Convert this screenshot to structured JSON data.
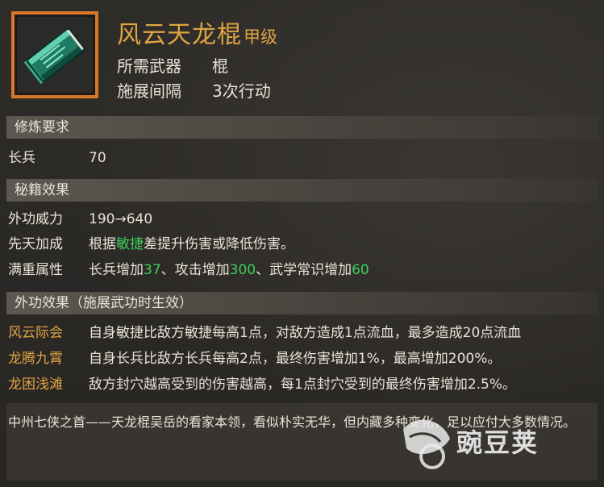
{
  "header": {
    "item_icon": "green-book-icon",
    "title": "风云天龙棍",
    "grade": "甲级",
    "meta": [
      {
        "label": "所需武器",
        "value": "棍"
      },
      {
        "label": "施展间隔",
        "value": "3次行动"
      }
    ]
  },
  "sections": {
    "requirements": "修炼要求",
    "effects": "秘籍效果",
    "external": "外功效果（施展武功时生效）"
  },
  "requirements": [
    {
      "label": "长兵",
      "value": "70"
    }
  ],
  "effects": {
    "power": {
      "label": "外功威力",
      "value": "190→640"
    },
    "innate": {
      "label": "先天加成",
      "pre": "根据",
      "hl": "敏捷",
      "post": "差提升伤害或降低伤害。"
    },
    "full": {
      "label": "满重属性",
      "t1": "长兵增加",
      "v1": "37",
      "t2": "、攻击增加",
      "v2": "300",
      "t3": "、武学常识增加",
      "v3": "60"
    }
  },
  "external": [
    {
      "label": "风云际会",
      "text": "自身敏捷比敌方敏捷每高1点，对敌方造成1点流血，最多造成20点流血"
    },
    {
      "label": "龙腾九霄",
      "text": "自身长兵比敌方长兵每高2点，最终伤害增加1%，最高增加200%。"
    },
    {
      "label": "龙困浅滩",
      "text": "敌方封穴越高受到的伤害越高，每1点封穴受到的最终伤害增加2.5%。"
    }
  ],
  "description": "中州七侠之首——天龙棍吴岳的看家本领，看似朴实无华，但内藏多种变化，足以应付大多数情况。",
  "watermark": "豌豆荚",
  "colors": {
    "gold": "#e0a443",
    "green": "#3fcf5c",
    "frame": "#d9782a"
  }
}
